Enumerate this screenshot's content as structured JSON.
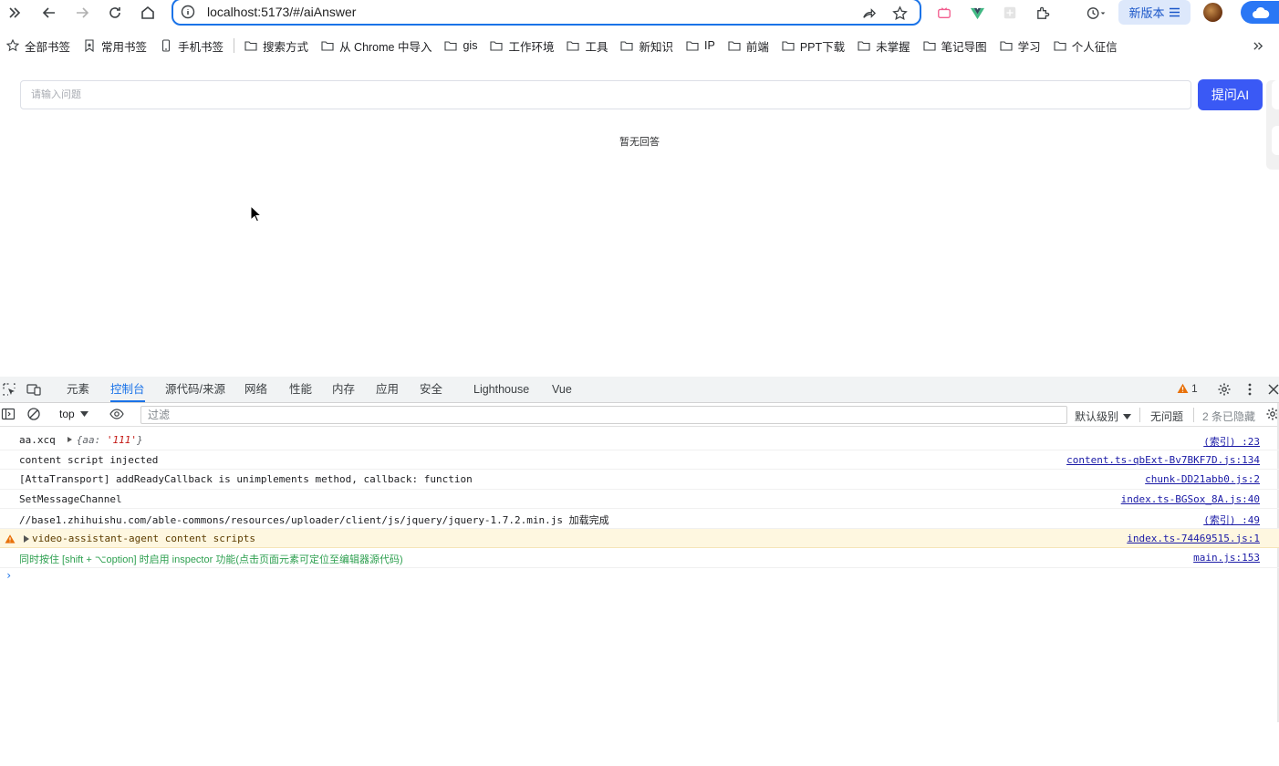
{
  "browser": {
    "url": "localhost:5173/#/aiAnswer",
    "new_version_label": "新版本"
  },
  "bookmarks": [
    {
      "label": "全部书签",
      "icon": "star-icon"
    },
    {
      "label": "常用书签",
      "icon": "bookmark-star-icon"
    },
    {
      "label": "手机书签",
      "icon": "phone-icon"
    },
    {
      "label": "搜索方式",
      "icon": "folder-icon"
    },
    {
      "label": "从 Chrome 中导入",
      "icon": "folder-icon"
    },
    {
      "label": "gis",
      "icon": "folder-icon"
    },
    {
      "label": "工作环境",
      "icon": "folder-icon"
    },
    {
      "label": "工具",
      "icon": "folder-icon"
    },
    {
      "label": "新知识",
      "icon": "folder-icon"
    },
    {
      "label": "IP",
      "icon": "folder-icon"
    },
    {
      "label": "前端",
      "icon": "folder-icon"
    },
    {
      "label": "PPT下载",
      "icon": "folder-icon"
    },
    {
      "label": "未掌握",
      "icon": "folder-icon"
    },
    {
      "label": "笔记导图",
      "icon": "folder-icon"
    },
    {
      "label": "学习",
      "icon": "folder-icon"
    },
    {
      "label": "个人征信",
      "icon": "folder-icon"
    }
  ],
  "page": {
    "question_placeholder": "请输入问题",
    "question_value": "",
    "ask_button_label": "提问AI",
    "empty_answer_text": "暂无回答"
  },
  "devtools": {
    "tabs": [
      "元素",
      "控制台",
      "源代码/来源",
      "网络",
      "性能",
      "内存",
      "应用",
      "安全",
      "Lighthouse",
      "Vue"
    ],
    "active_tab": "控制台",
    "warning_count": "1",
    "context": "top",
    "filter_placeholder": "过滤",
    "level_label": "默认级别",
    "issues_label": "无问题",
    "hidden_label": "2 条已隐藏",
    "logs": [
      {
        "msg_prefix": "aa.xcq",
        "obj_key": "aa",
        "obj_value": "'111'",
        "source": "(索引) :23",
        "type": "object"
      },
      {
        "msg": "content script injected",
        "source": "content.ts-qbExt-Bv7BKF7D.js:134",
        "type": "log"
      },
      {
        "msg": "[AttaTransport] addReadyCallback is unimplements method, callback: function",
        "source": "chunk-DD21abb0.js:2",
        "type": "log"
      },
      {
        "msg": "SetMessageChannel",
        "source": "index.ts-BGSox_8A.js:40",
        "type": "log"
      },
      {
        "msg": "//base1.zhihuishu.com/able-commons/resources/uploader/client/js/jquery/jquery-1.7.2.min.js 加载完成",
        "source": "(索引) :49",
        "type": "log"
      },
      {
        "msg": "video-assistant-agent content scripts",
        "source": "index.ts-74469515.js:1",
        "type": "warn"
      },
      {
        "msg": "同时按住 [shift + ⌥option] 时启用 inspector 功能(点击页面元素可定位至编辑器源代码)",
        "source": "main.js:153",
        "type": "green"
      }
    ]
  },
  "colors": {
    "accent": "#1a73e8",
    "ask_button": "#3a59f5",
    "warn_bg": "#fef7e0",
    "green_text": "#2ea050"
  }
}
